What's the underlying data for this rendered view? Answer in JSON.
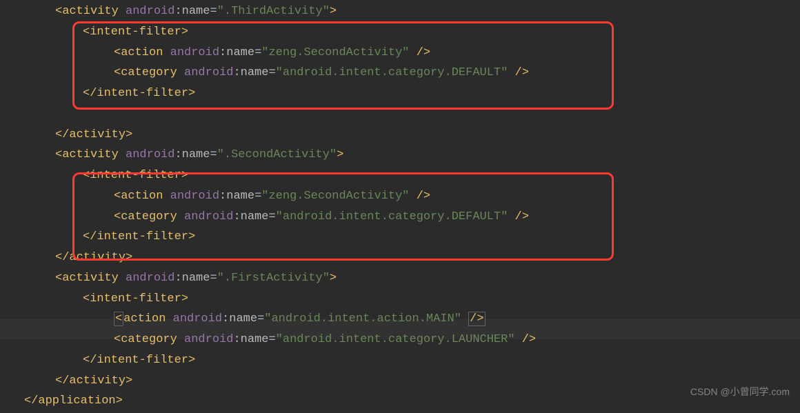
{
  "code": {
    "line1_tag": "activity",
    "line1_attr_ns": "android",
    "line1_attr_name": "name",
    "line1_attr_val": "\".ThirdActivity\"",
    "line2_tag": "intent-filter",
    "line3_tag": "action",
    "line3_attr_ns": "android",
    "line3_attr_name": "name",
    "line3_attr_val": "\"zeng.SecondActivity\"",
    "line4_tag": "category",
    "line4_attr_ns": "android",
    "line4_attr_name": "name",
    "line4_attr_val": "\"android.intent.category.DEFAULT\"",
    "line5_tag": "intent-filter",
    "line6_tag": "activity",
    "line7_tag": "activity",
    "line7_attr_ns": "android",
    "line7_attr_name": "name",
    "line7_attr_val": "\".SecondActivity\"",
    "line8_tag": "intent-filter",
    "line9_tag": "action",
    "line9_attr_ns": "android",
    "line9_attr_name": "name",
    "line9_attr_val": "\"zeng.SecondActivity\"",
    "line10_tag": "category",
    "line10_attr_ns": "android",
    "line10_attr_name": "name",
    "line10_attr_val": "\"android.intent.category.DEFAULT\"",
    "line11_tag": "intent-filter",
    "line12_tag": "activity",
    "line13_tag": "activity",
    "line13_attr_ns": "android",
    "line13_attr_name": "name",
    "line13_attr_val": "\".FirstActivity\"",
    "line14_tag": "intent-filter",
    "line15_tag": "action",
    "line15_attr_ns": "android",
    "line15_attr_name": "name",
    "line15_attr_val": "\"android.intent.action.MAIN\"",
    "line16_tag": "category",
    "line16_attr_ns": "android",
    "line16_attr_name": "name",
    "line16_attr_val": "\"android.intent.category.LAUNCHER\"",
    "line17_tag": "intent-filter",
    "line18_tag": "activity",
    "line19_tag": "application"
  },
  "watermark": "CSDN @小曾同学.com"
}
